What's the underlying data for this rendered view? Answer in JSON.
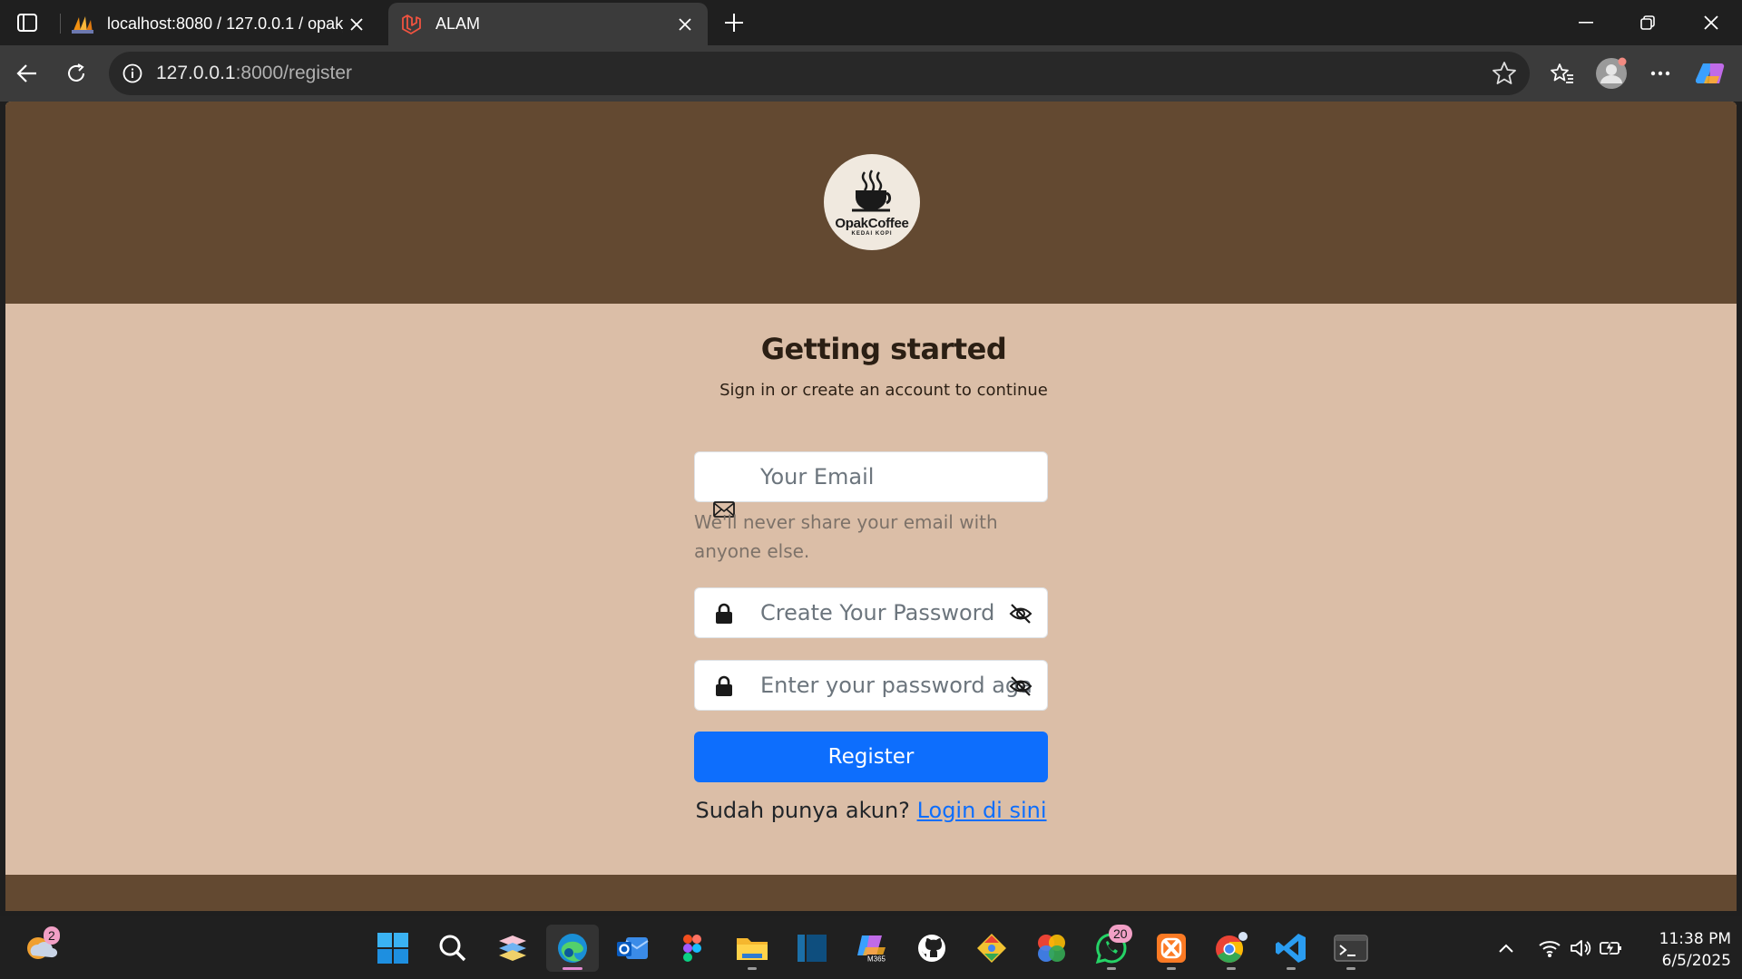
{
  "browser": {
    "tabs": [
      {
        "title": "localhost:8080 / 127.0.0.1 / opak_",
        "icon": "phpmyadmin-icon"
      },
      {
        "title": "ALAM",
        "icon": "laravel-icon"
      }
    ],
    "url_host": "127.0.0.1",
    "url_path": ":8000/register"
  },
  "page": {
    "logo_brand": "OpakCoffee",
    "logo_sub": "KEDAI KOPI",
    "heading": "Getting started",
    "subheading": "Sign in or create an account to continue",
    "email_placeholder": "Your Email",
    "email_help": "We'll never share your email with anyone else.",
    "password_placeholder": "Create Your Password",
    "confirm_placeholder": "Enter your password again",
    "register_label": "Register",
    "login_prompt": "Sudah punya akun?",
    "login_link": "Login di sini",
    "colors": {
      "header": "#634931",
      "body": "#dbbea7",
      "primary": "#0d6efd"
    }
  },
  "taskbar": {
    "weather_badge": "2",
    "whatsapp_badge": "20",
    "time": "11:38 PM",
    "date": "6/5/2025"
  }
}
